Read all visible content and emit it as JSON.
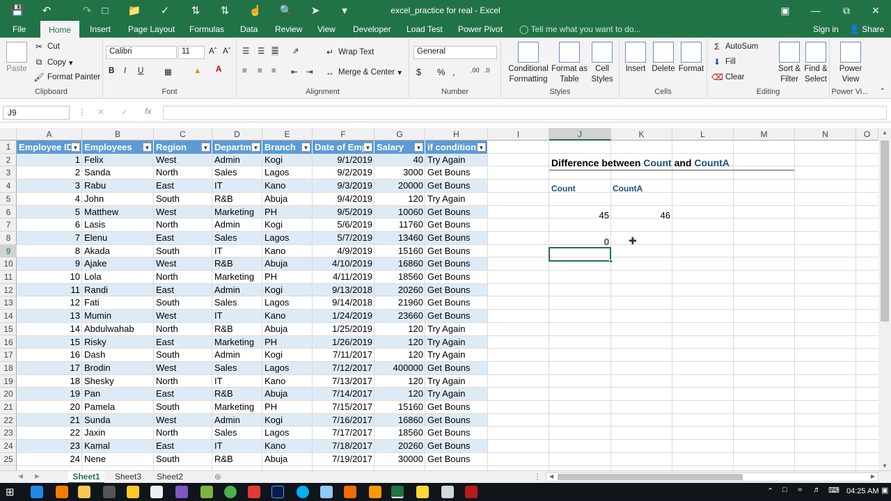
{
  "window": {
    "title": "excel_practice for real - Excel"
  },
  "ribbon_tabs": [
    "File",
    "Home",
    "Insert",
    "Page Layout",
    "Formulas",
    "Data",
    "Review",
    "View",
    "Developer",
    "Load Test",
    "Power Pivot"
  ],
  "tell_me": "Tell me what you want to do...",
  "sign_in": "Sign in",
  "share": "Share",
  "clipboard": {
    "paste": "Paste",
    "cut": "Cut",
    "copy": "Copy",
    "format_painter": "Format Painter",
    "label": "Clipboard"
  },
  "font": {
    "name": "Calibri",
    "size": "11",
    "label": "Font",
    "bold": "B",
    "italic": "I",
    "underline": "U"
  },
  "alignment": {
    "wrap": "Wrap Text",
    "merge": "Merge & Center",
    "label": "Alignment"
  },
  "number": {
    "format": "General",
    "label": "Number",
    "currency": "$",
    "percent": "%",
    "comma": ","
  },
  "styles": {
    "cond": "Conditional Formatting",
    "table": "Format as Table",
    "cell": "Cell Styles",
    "label": "Styles"
  },
  "cells": {
    "insert": "Insert",
    "delete": "Delete",
    "format": "Format",
    "label": "Cells"
  },
  "editing": {
    "autosum": "AutoSum",
    "fill": "Fill",
    "clear": "Clear",
    "sort": "Sort & Filter",
    "find": "Find & Select",
    "label": "Editing"
  },
  "powerview": {
    "btn": "Power View",
    "label": "Power Vi..."
  },
  "name_box": "J9",
  "columns": [
    "A",
    "B",
    "C",
    "D",
    "E",
    "F",
    "G",
    "H",
    "I",
    "J",
    "K",
    "L",
    "M",
    "N",
    "O"
  ],
  "selected_column": "J",
  "selected_row": 9,
  "table_headers": [
    "Employee ID",
    "Employees",
    "Region",
    "Departme",
    "Branch",
    "Date of Emp",
    "Salary",
    "if condition"
  ],
  "rows": [
    [
      "1",
      "Felix",
      "West",
      "Admin",
      "Kogi",
      "9/1/2019",
      "40",
      "Try Again"
    ],
    [
      "2",
      "Sanda",
      "North",
      "Sales",
      "Lagos",
      "9/2/2019",
      "3000",
      "Get Bouns"
    ],
    [
      "3",
      "Rabu",
      "East",
      "IT",
      "Kano",
      "9/3/2019",
      "20000",
      "Get Bouns"
    ],
    [
      "4",
      "John",
      "South",
      "R&B",
      "Abuja",
      "9/4/2019",
      "120",
      "Try Again"
    ],
    [
      "5",
      "Matthew",
      "West",
      "Marketing",
      "PH",
      "9/5/2019",
      "10060",
      "Get Bouns"
    ],
    [
      "6",
      "Lasis",
      "North",
      "Admin",
      "Kogi",
      "5/6/2019",
      "11760",
      "Get Bouns"
    ],
    [
      "7",
      "Elenu",
      "East",
      "Sales",
      "Lagos",
      "5/7/2019",
      "13460",
      "Get Bouns"
    ],
    [
      "8",
      "Akada",
      "South",
      "IT",
      "Kano",
      "4/9/2019",
      "15160",
      "Get Bouns"
    ],
    [
      "9",
      "Ajake",
      "West",
      "R&B",
      "Abuja",
      "4/10/2019",
      "16860",
      "Get Bouns"
    ],
    [
      "10",
      "Lola",
      "North",
      "Marketing",
      "PH",
      "4/11/2019",
      "18560",
      "Get Bouns"
    ],
    [
      "11",
      "Randi",
      "East",
      "Admin",
      "Kogi",
      "9/13/2018",
      "20260",
      "Get Bouns"
    ],
    [
      "12",
      "Fati",
      "South",
      "Sales",
      "Lagos",
      "9/14/2018",
      "21960",
      "Get Bouns"
    ],
    [
      "13",
      "Mumin",
      "West",
      "IT",
      "Kano",
      "1/24/2019",
      "23660",
      "Get Bouns"
    ],
    [
      "14",
      "Abdulwahab",
      "North",
      "R&B",
      "Abuja",
      "1/25/2019",
      "120",
      "Try Again"
    ],
    [
      "15",
      "Risky",
      "East",
      "Marketing",
      "PH",
      "1/26/2019",
      "120",
      "Try Again"
    ],
    [
      "16",
      "Dash",
      "South",
      "Admin",
      "Kogi",
      "7/11/2017",
      "120",
      "Try Again"
    ],
    [
      "17",
      "Brodin",
      "West",
      "Sales",
      "Lagos",
      "7/12/2017",
      "400000",
      "Get Bouns"
    ],
    [
      "18",
      "Shesky",
      "North",
      "IT",
      "Kano",
      "7/13/2017",
      "120",
      "Try Again"
    ],
    [
      "19",
      "Pan",
      "East",
      "R&B",
      "Abuja",
      "7/14/2017",
      "120",
      "Try Again"
    ],
    [
      "20",
      "Pamela",
      "South",
      "Marketing",
      "PH",
      "7/15/2017",
      "15160",
      "Get Bouns"
    ],
    [
      "21",
      "Sunda",
      "West",
      "Admin",
      "Kogi",
      "7/16/2017",
      "16860",
      "Get Bouns"
    ],
    [
      "22",
      "Jaxin",
      "North",
      "Sales",
      "Lagos",
      "7/17/2017",
      "18560",
      "Get Bouns"
    ],
    [
      "23",
      "Kamal",
      "East",
      "IT",
      "Kano",
      "7/18/2017",
      "20260",
      "Get Bouns"
    ],
    [
      "24",
      "Nene",
      "South",
      "R&B",
      "Abuja",
      "7/19/2017",
      "30000",
      "Get Bouns"
    ]
  ],
  "side": {
    "title_pre": "Difference between ",
    "title_a": "Count",
    "title_mid": " and ",
    "title_b": "CountA",
    "count_label": "Count",
    "counta_label": "CountA",
    "count_value": "45",
    "counta_value": "46",
    "zero_value": "0"
  },
  "sheets": [
    "Sheet1",
    "Sheet3",
    "Sheet2"
  ],
  "active_sheet": "Sheet1",
  "clock": "04:25 AM",
  "colors": {
    "excel_green": "#217346",
    "table_header": "#5b9bd5",
    "band": "#ddebf7",
    "accent_text": "#1f4e79"
  }
}
